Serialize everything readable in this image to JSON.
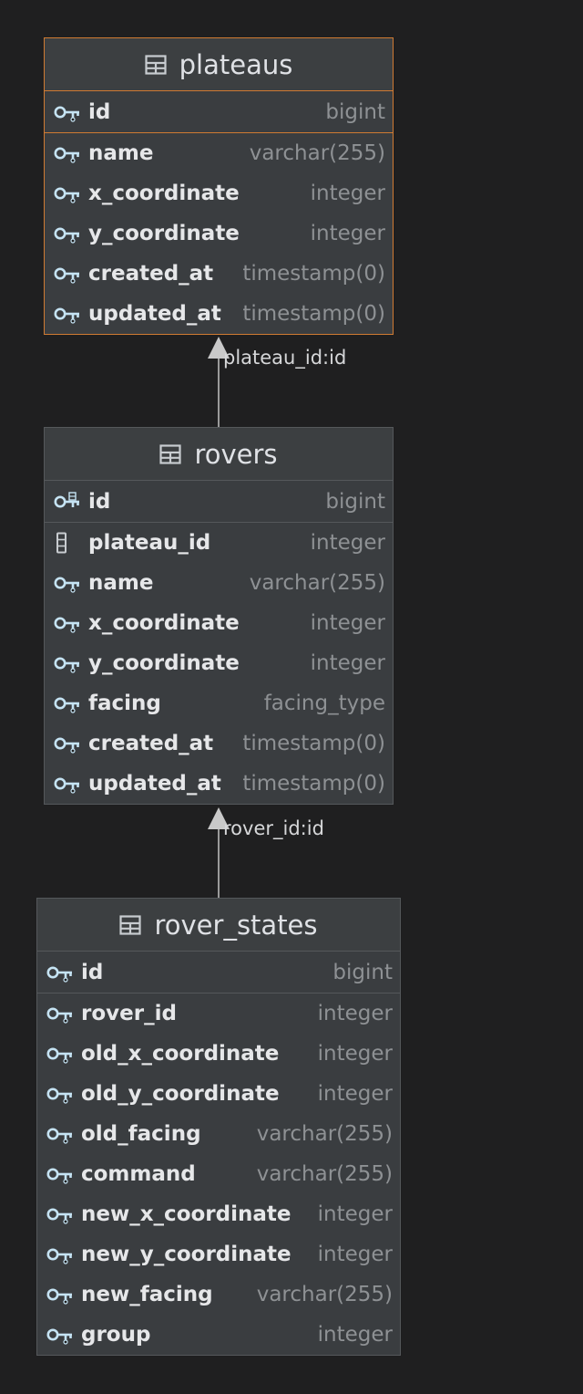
{
  "tables": [
    {
      "name": "plateaus",
      "selected": true,
      "columns": [
        {
          "name": "id",
          "type": "bigint",
          "icon": "key-icon",
          "pk": true
        },
        {
          "name": "name",
          "type": "varchar(255)",
          "icon": "key-icon"
        },
        {
          "name": "x_coordinate",
          "type": "integer",
          "icon": "key-icon"
        },
        {
          "name": "y_coordinate",
          "type": "integer",
          "icon": "key-icon"
        },
        {
          "name": "created_at",
          "type": "timestamp(0)",
          "icon": "key-icon"
        },
        {
          "name": "updated_at",
          "type": "timestamp(0)",
          "icon": "key-icon"
        }
      ]
    },
    {
      "name": "rovers",
      "selected": false,
      "columns": [
        {
          "name": "id",
          "type": "bigint",
          "icon": "key-index-icon",
          "pk": true
        },
        {
          "name": "plateau_id",
          "type": "integer",
          "icon": "column-icon"
        },
        {
          "name": "name",
          "type": "varchar(255)",
          "icon": "key-icon"
        },
        {
          "name": "x_coordinate",
          "type": "integer",
          "icon": "key-icon"
        },
        {
          "name": "y_coordinate",
          "type": "integer",
          "icon": "key-icon"
        },
        {
          "name": "facing",
          "type": "facing_type",
          "icon": "key-icon"
        },
        {
          "name": "created_at",
          "type": "timestamp(0)",
          "icon": "key-icon"
        },
        {
          "name": "updated_at",
          "type": "timestamp(0)",
          "icon": "key-icon"
        }
      ]
    },
    {
      "name": "rover_states",
      "selected": false,
      "columns": [
        {
          "name": "id",
          "type": "bigint",
          "icon": "key-icon",
          "pk": true
        },
        {
          "name": "rover_id",
          "type": "integer",
          "icon": "key-icon"
        },
        {
          "name": "old_x_coordinate",
          "type": "integer",
          "icon": "key-icon"
        },
        {
          "name": "old_y_coordinate",
          "type": "integer",
          "icon": "key-icon"
        },
        {
          "name": "old_facing",
          "type": "varchar(255)",
          "icon": "key-icon"
        },
        {
          "name": "command",
          "type": "varchar(255)",
          "icon": "key-icon"
        },
        {
          "name": "new_x_coordinate",
          "type": "integer",
          "icon": "key-icon"
        },
        {
          "name": "new_y_coordinate",
          "type": "integer",
          "icon": "key-icon"
        },
        {
          "name": "new_facing",
          "type": "varchar(255)",
          "icon": "key-icon"
        },
        {
          "name": "group",
          "type": "integer",
          "icon": "key-icon"
        }
      ]
    }
  ],
  "relations": [
    {
      "label": "plateau_id:id",
      "from": "rovers",
      "to": "plateaus"
    },
    {
      "label": "rover_id:id",
      "from": "rover_states",
      "to": "rovers"
    }
  ],
  "colors": {
    "background": "#1f1f20",
    "table_body": "#3a3d40",
    "selected_border": "#cf7a32",
    "key_icon": "#c5e3f3",
    "type_text": "#8e9194"
  }
}
